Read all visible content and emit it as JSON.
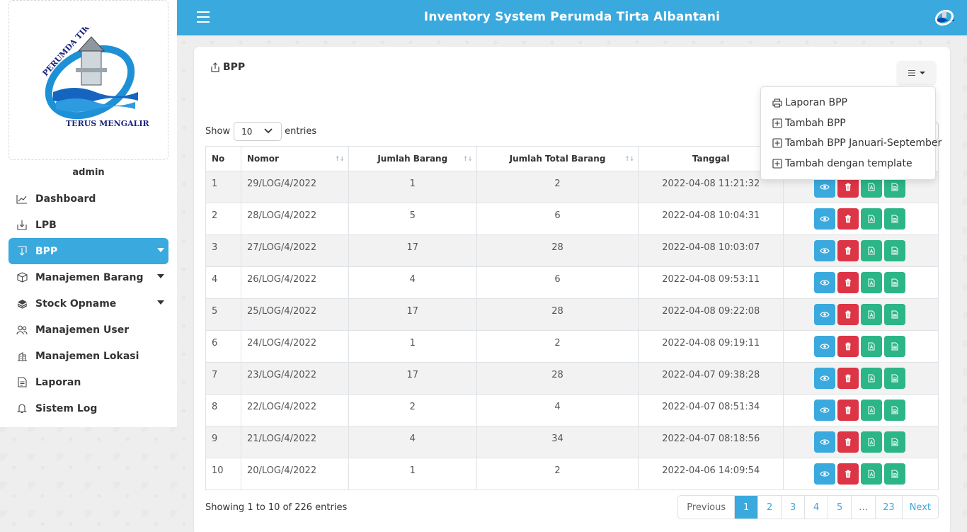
{
  "app": {
    "title": "Inventory System Perumda Tirta Albantani"
  },
  "sidebar": {
    "logo": {
      "top_text": "PERUMDA TIRTA ALBANTANI",
      "bottom_text": "TERUS MENGALIR"
    },
    "username": "admin",
    "items": [
      {
        "label": "Dashboard",
        "icon": "chart-line-icon",
        "active": false,
        "has_caret": false
      },
      {
        "label": "LPB",
        "icon": "download-icon",
        "active": false,
        "has_caret": false
      },
      {
        "label": "BPP",
        "icon": "download-box-icon",
        "active": true,
        "has_caret": true
      },
      {
        "label": "Manajemen Barang",
        "icon": "box-icon",
        "active": false,
        "has_caret": true
      },
      {
        "label": "Stock Opname",
        "icon": "layers-icon",
        "active": false,
        "has_caret": true
      },
      {
        "label": "Manajemen User",
        "icon": "users-icon",
        "active": false,
        "has_caret": false
      },
      {
        "label": "Manajemen Lokasi",
        "icon": "building-icon",
        "active": false,
        "has_caret": false
      },
      {
        "label": "Laporan",
        "icon": "file-text-icon",
        "active": false,
        "has_caret": false
      },
      {
        "label": "Sistem Log",
        "icon": "bell-icon",
        "active": false,
        "has_caret": false
      }
    ]
  },
  "page": {
    "title": "BPP",
    "dropdown": [
      {
        "label": "Laporan BPP",
        "icon": "printer-icon"
      },
      {
        "label": "Tambah BPP",
        "icon": "plus-square-icon"
      },
      {
        "label": "Tambah BPP Januari-September",
        "icon": "plus-square-icon"
      },
      {
        "label": "Tambah dengan template",
        "icon": "plus-square-icon"
      }
    ]
  },
  "table": {
    "length": {
      "show": "Show",
      "value": "10",
      "entries": "entries"
    },
    "columns": [
      "No",
      "Nomor",
      "Jumlah Barang",
      "Jumlah Total Barang",
      "Tanggal",
      ""
    ],
    "rows": [
      [
        "1",
        "29/LOG/4/2022",
        "1",
        "2",
        "2022-04-08 11:21:32"
      ],
      [
        "2",
        "28/LOG/4/2022",
        "5",
        "6",
        "2022-04-08 10:04:31"
      ],
      [
        "3",
        "27/LOG/4/2022",
        "17",
        "28",
        "2022-04-08 10:03:07"
      ],
      [
        "4",
        "26/LOG/4/2022",
        "4",
        "6",
        "2022-04-08 09:53:11"
      ],
      [
        "5",
        "25/LOG/4/2022",
        "17",
        "28",
        "2022-04-08 09:22:08"
      ],
      [
        "6",
        "24/LOG/4/2022",
        "1",
        "2",
        "2022-04-08 09:19:11"
      ],
      [
        "7",
        "23/LOG/4/2022",
        "17",
        "28",
        "2022-04-07 09:38:28"
      ],
      [
        "8",
        "22/LOG/4/2022",
        "2",
        "4",
        "2022-04-07 08:51:34"
      ],
      [
        "9",
        "21/LOG/4/2022",
        "4",
        "34",
        "2022-04-07 08:18:56"
      ],
      [
        "10",
        "20/LOG/4/2022",
        "1",
        "2",
        "2022-04-06 14:09:54"
      ]
    ],
    "info": "Showing 1 to 10 of 226 entries",
    "pagination": [
      "Previous",
      "1",
      "2",
      "3",
      "4",
      "5",
      "…",
      "23",
      "Next"
    ],
    "active_page": "1"
  },
  "colors": {
    "primary": "#3aa9dd",
    "danger": "#dc3545",
    "success": "#2cb586"
  }
}
